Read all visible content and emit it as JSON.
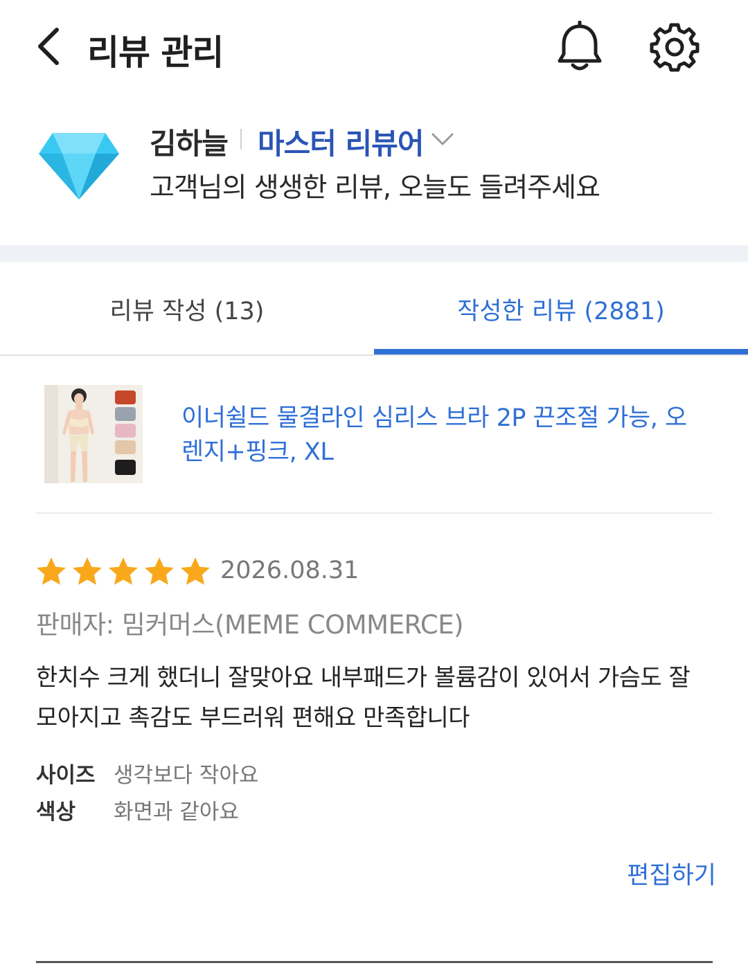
{
  "header": {
    "title": "리뷰 관리",
    "back_icon": "chevron-left-icon",
    "bell_icon": "bell-icon",
    "settings_icon": "gear-icon"
  },
  "profile": {
    "badge_icon": "diamond-icon",
    "name": "김하늘",
    "grade": "마스터 리뷰어",
    "message": "고객님의 생생한 리뷰, 오늘도 들려주세요"
  },
  "tabs": [
    {
      "label": "리뷰 작성 (13)",
      "active": false
    },
    {
      "label": "작성한 리뷰 (2881)",
      "active": true
    }
  ],
  "review": {
    "product_title": "이너쉴드 물결라인 심리스 브라 2P 끈조절 가능, 오렌지+핑크, XL",
    "rating": 5,
    "date": "2026.08.31",
    "seller": "판매자: 밈커머스(MEME COMMERCE)",
    "body": "한치수 크게 했더니 잘맞아요 내부패드가 볼륨감이 있어서 가슴도 잘 모아지고 촉감도 부드러워 편해요 만족합니다",
    "attributes": [
      {
        "label": "사이즈",
        "value": "생각보다 작아요"
      },
      {
        "label": "색상",
        "value": "화면과 같아요"
      }
    ],
    "edit_label": "편집하기"
  },
  "colors": {
    "accent": "#2f6fd6",
    "grade": "#2b55b5",
    "star": "#f8a81a",
    "diamond": "#39c8f2"
  }
}
